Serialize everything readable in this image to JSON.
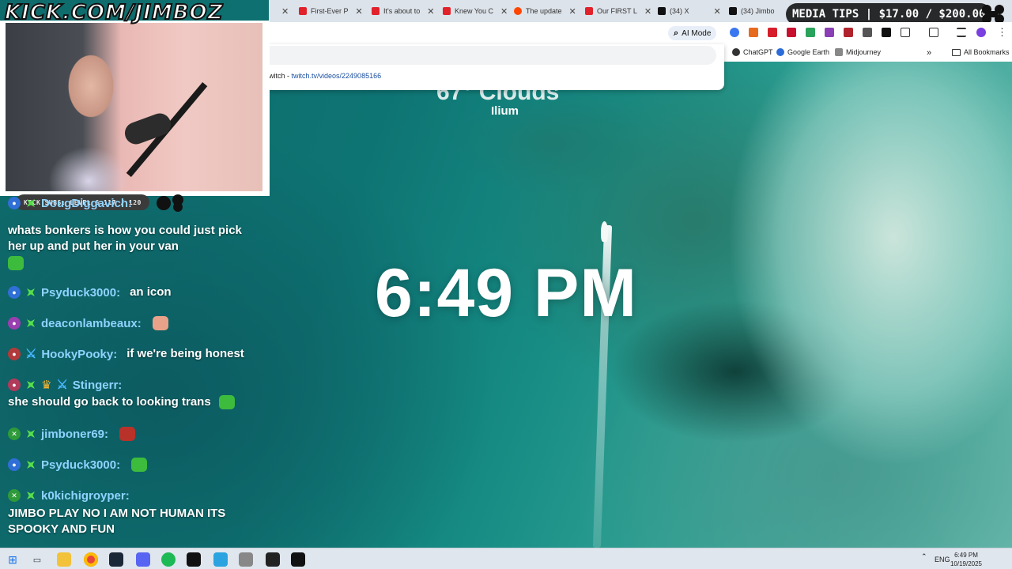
{
  "desktop": {
    "clock_time": "6:49 PM",
    "weather_temp": "67° Clouds",
    "weather_location": "Ilium"
  },
  "overlay": {
    "watermark": "KICK.COM/JIMBOZ",
    "subs_label": "KICK SUBS: LEVEL 6 117 / 120",
    "media_tips": "MEDIA TIPS | $17.00 / $200.00"
  },
  "browser": {
    "tabs": [
      {
        "label": "First-Ever P",
        "color": "#e1222b"
      },
      {
        "label": "It's about to",
        "color": "#e1222b"
      },
      {
        "label": "Knew You C",
        "color": "#e1222b"
      },
      {
        "label": "The update",
        "color": "#ff4500"
      },
      {
        "label": "Our FIRST L",
        "color": "#e1222b"
      },
      {
        "label": "(34) X",
        "color": "#111111"
      },
      {
        "label": "(34) Jimbo",
        "color": "#111111"
      }
    ],
    "ai_mode_label": "AI Mode",
    "omnibox_suggestion_prefix": "witch - ",
    "omnibox_suggestion_url": "twitch.tv/videos/2249085166",
    "bookmarks": [
      "ChatGPT",
      "Google Earth",
      "Midjourney"
    ],
    "all_bookmarks": "All Bookmarks",
    "chevron": "»"
  },
  "chat": {
    "messages": [
      {
        "user": "DougDiggavich:",
        "user_color": "#8fd3ff",
        "text": "whats bonkers is how you could just pick her up and put her in your van"
      },
      {
        "user": "Psyduck3000:",
        "user_color": "#8fd3ff",
        "text": "an icon"
      },
      {
        "user": "deaconlambeaux:",
        "user_color": "#8fd3ff",
        "text": ""
      },
      {
        "user": "HookyPooky:",
        "user_color": "#8fd3ff",
        "text": "if we're being honest"
      },
      {
        "user": "Stingerr:",
        "user_color": "#8fd3ff",
        "text": "she should go back to looking trans"
      },
      {
        "user": "jimboner69:",
        "user_color": "#8fd3ff",
        "text": ""
      },
      {
        "user": "Psyduck3000:",
        "user_color": "#8fd3ff",
        "text": ""
      },
      {
        "user": "k0kichigroyper:",
        "user_color": "#8fd3ff",
        "text": "JIMBO PLAY NO I AM NOT HUMAN ITS SPOOKY AND FUN"
      }
    ]
  },
  "taskbar": {
    "lang": "ENG",
    "time": "6:49 PM",
    "date": "10/19/2025",
    "tray_up": "⌃"
  }
}
